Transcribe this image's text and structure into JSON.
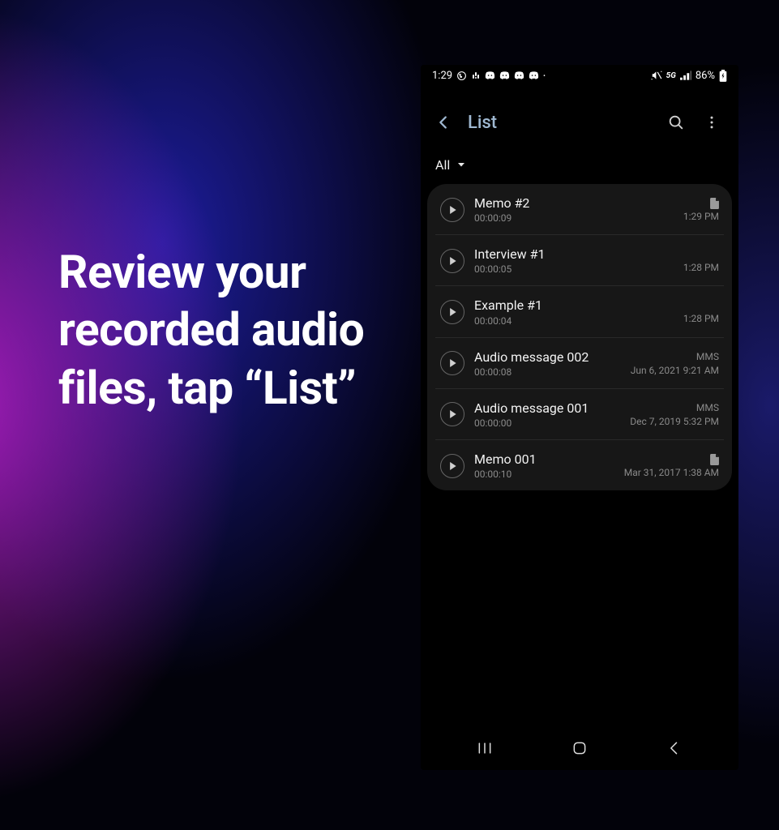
{
  "caption": "Review your recorded audio files, tap “List”",
  "status": {
    "time": "1:29",
    "network_label": "5G",
    "battery_pct": "86%"
  },
  "appbar": {
    "title": "List"
  },
  "filter": {
    "label": "All"
  },
  "recordings": [
    {
      "title": "Memo #2",
      "duration": "00:00:09",
      "badge": "file",
      "meta": "1:29 PM"
    },
    {
      "title": "Interview #1",
      "duration": "00:00:05",
      "badge": "",
      "meta": "1:28 PM"
    },
    {
      "title": "Example #1",
      "duration": "00:00:04",
      "badge": "",
      "meta": "1:28 PM"
    },
    {
      "title": "Audio message 002",
      "duration": "00:00:08",
      "badge": "MMS",
      "meta": "Jun 6, 2021 9:21 AM"
    },
    {
      "title": "Audio message 001",
      "duration": "00:00:00",
      "badge": "MMS",
      "meta": "Dec 7, 2019 5:32 PM"
    },
    {
      "title": "Memo 001",
      "duration": "00:00:10",
      "badge": "file",
      "meta": "Mar 31, 2017 1:38 AM"
    }
  ]
}
